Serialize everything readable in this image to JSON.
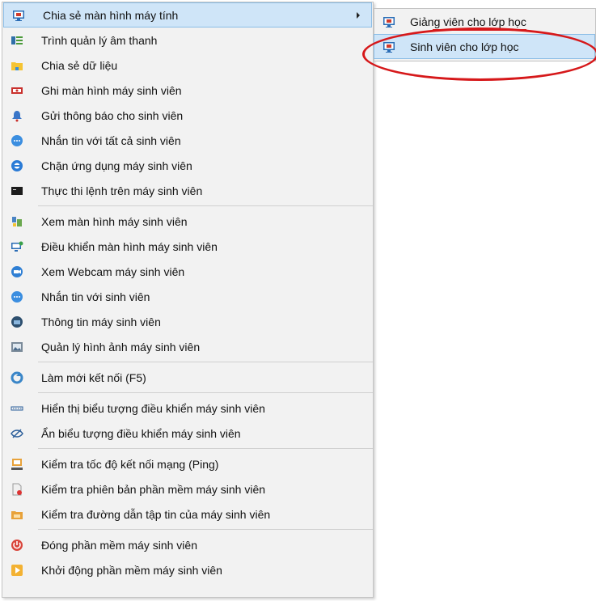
{
  "menu": {
    "items": [
      {
        "id": "share-screen",
        "label": "Chia sẻ màn hình máy tính",
        "icon": "monitor-share-icon",
        "submenu": true,
        "highlight": true
      },
      {
        "id": "audio-manager",
        "label": "Trình quản lý âm thanh",
        "icon": "audio-manager-icon"
      },
      {
        "id": "share-data",
        "label": "Chia sẻ dữ liệu",
        "icon": "folder-icon"
      },
      {
        "id": "record-screen",
        "label": "Ghi màn hình máy sinh viên",
        "icon": "record-icon"
      },
      {
        "id": "send-notice",
        "label": "Gửi thông báo cho sinh viên",
        "icon": "bell-icon"
      },
      {
        "id": "message-all",
        "label": "Nhắn tin với tất cả sinh viên",
        "icon": "chat-bubble-icon"
      },
      {
        "id": "block-app",
        "label": "Chặn ứng dụng máy sinh viên",
        "icon": "block-app-icon"
      },
      {
        "id": "run-command",
        "label": "Thực thi lệnh trên máy sinh viên",
        "icon": "terminal-icon",
        "sep_after": true
      },
      {
        "id": "view-screen",
        "label": "Xem màn hình máy sinh viên",
        "icon": "view-screen-icon"
      },
      {
        "id": "control-screen",
        "label": "Điều khiển màn hình máy sinh viên",
        "icon": "remote-control-icon"
      },
      {
        "id": "view-webcam",
        "label": "Xem Webcam máy sinh viên",
        "icon": "webcam-icon"
      },
      {
        "id": "message-student",
        "label": "Nhắn tin với sinh viên",
        "icon": "chat-bubble-icon"
      },
      {
        "id": "machine-info",
        "label": "Thông tin máy sinh viên",
        "icon": "info-icon"
      },
      {
        "id": "image-manager",
        "label": "Quản lý hình ảnh máy sinh viên",
        "icon": "image-manager-icon",
        "sep_after": true
      },
      {
        "id": "refresh",
        "label": "Làm mới kết nối (F5)",
        "icon": "refresh-icon",
        "sep_after": true
      },
      {
        "id": "show-control-icon",
        "label": "Hiển thị biểu tượng điều khiển máy sinh viên",
        "icon": "dots-icon"
      },
      {
        "id": "hide-control-icon",
        "label": "Ẩn biểu tượng điều khiển máy sinh viên",
        "icon": "eye-hide-icon",
        "sep_after": true
      },
      {
        "id": "ping",
        "label": "Kiểm tra tốc độ kết nối mạng (Ping)",
        "icon": "network-icon"
      },
      {
        "id": "check-version",
        "label": "Kiểm tra phiên bản phần mềm máy sinh viên",
        "icon": "document-icon"
      },
      {
        "id": "check-path",
        "label": "Kiểm tra đường dẫn tập tin của máy sinh viên",
        "icon": "folder-path-icon",
        "sep_after": true
      },
      {
        "id": "close-software",
        "label": "Đóng phần mềm máy sinh viên",
        "icon": "power-icon"
      },
      {
        "id": "start-software",
        "label": "Khởi động phần mềm máy sinh viên",
        "icon": "start-icon"
      }
    ]
  },
  "submenu": {
    "items": [
      {
        "id": "teacher",
        "label": "Giảng viên cho lớp học",
        "icon": "monitor-share-icon",
        "strike": true
      },
      {
        "id": "student",
        "label": "Sinh viên cho lớp học",
        "icon": "monitor-share-icon",
        "highlight": true
      }
    ]
  },
  "colors": {
    "accent": "#cfe5f8",
    "highlight_border": "#8bbde6",
    "annotation": "#d6181a",
    "menu_bg": "#f2f2f2"
  }
}
